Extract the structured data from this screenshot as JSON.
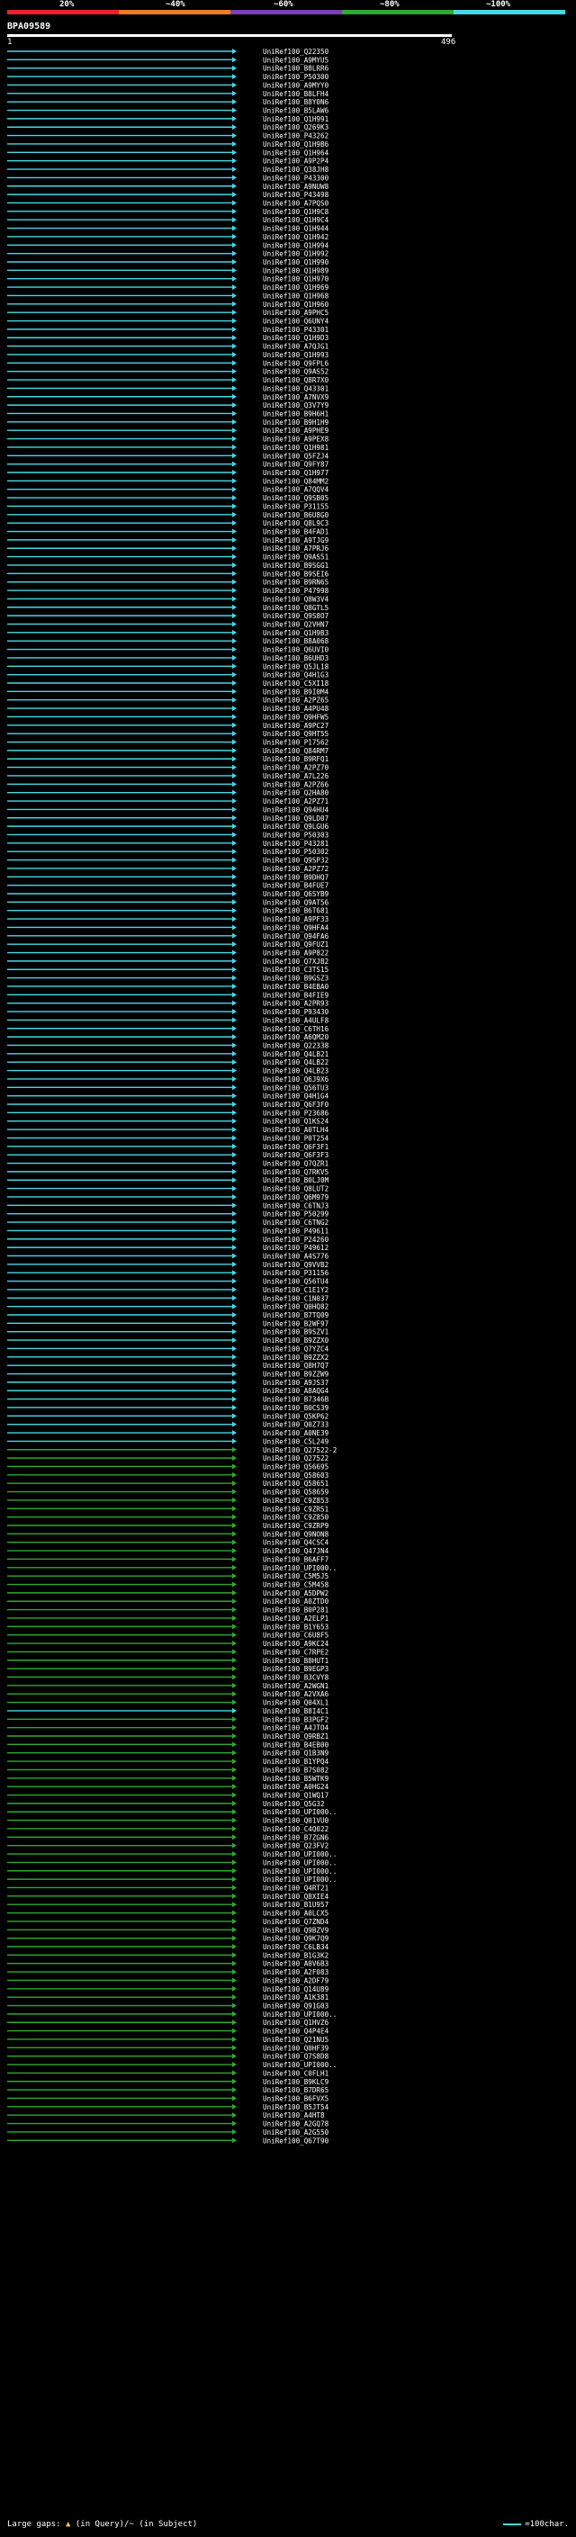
{
  "legend": {
    "labels": [
      "20%",
      "~40%",
      "~60%",
      "~80%",
      "~100%"
    ],
    "colors": [
      "#e8212b",
      "#f07c1b",
      "#7b3fb8",
      "#2eaa2e",
      "#44d9e6"
    ]
  },
  "query": {
    "id": "BPA09589",
    "start": "1",
    "end": "496"
  },
  "hits": [
    {
      "id": "UniRef100_Q22350",
      "color": "cyan"
    },
    {
      "id": "UniRef100_A9MYU5",
      "color": "cyan"
    },
    {
      "id": "UniRef100_B8LRR6",
      "color": "cyan"
    },
    {
      "id": "UniRef100_P50300",
      "color": "cyan"
    },
    {
      "id": "UniRef100_A9MYY0",
      "color": "cyan"
    },
    {
      "id": "UniRef100_B8LFH4",
      "color": "cyan"
    },
    {
      "id": "UniRef100_B8Y0N6",
      "color": "cyan"
    },
    {
      "id": "UniRef100_B5LAW6",
      "color": "cyan"
    },
    {
      "id": "UniRef100_Q1H991",
      "color": "cyan"
    },
    {
      "id": "UniRef100_Q269K3",
      "color": "cyan"
    },
    {
      "id": "UniRef100_P43262",
      "color": "cyan"
    },
    {
      "id": "UniRef100_Q1H9B6",
      "color": "cyan"
    },
    {
      "id": "UniRef100_Q1H964",
      "color": "cyan"
    },
    {
      "id": "UniRef100_A9P2P4",
      "color": "cyan"
    },
    {
      "id": "UniRef100_Q38JH8",
      "color": "cyan"
    },
    {
      "id": "UniRef100_P43300",
      "color": "cyan"
    },
    {
      "id": "UniRef100_A9NUW8",
      "color": "cyan"
    },
    {
      "id": "UniRef100_P43498",
      "color": "cyan"
    },
    {
      "id": "UniRef100_A7PQS0",
      "color": "cyan"
    },
    {
      "id": "UniRef100_Q1H9C8",
      "color": "cyan"
    },
    {
      "id": "UniRef100_Q1H9C4",
      "color": "cyan"
    },
    {
      "id": "UniRef100_Q1H944",
      "color": "cyan"
    },
    {
      "id": "UniRef100_Q1H942",
      "color": "cyan"
    },
    {
      "id": "UniRef100_Q1H994",
      "color": "cyan"
    },
    {
      "id": "UniRef100_Q1H992",
      "color": "cyan"
    },
    {
      "id": "UniRef100_Q1H990",
      "color": "cyan"
    },
    {
      "id": "UniRef100_Q1H989",
      "color": "cyan"
    },
    {
      "id": "UniRef100_Q1H970",
      "color": "cyan"
    },
    {
      "id": "UniRef100_Q1H969",
      "color": "cyan"
    },
    {
      "id": "UniRef100_Q1H968",
      "color": "cyan"
    },
    {
      "id": "UniRef100_Q1H960",
      "color": "cyan"
    },
    {
      "id": "UniRef100_A9PHC5",
      "color": "cyan"
    },
    {
      "id": "UniRef100_Q6UNY4",
      "color": "cyan"
    },
    {
      "id": "UniRef100_P43301",
      "color": "cyan"
    },
    {
      "id": "UniRef100_Q1H9D3",
      "color": "cyan"
    },
    {
      "id": "UniRef100_A7QJG1",
      "color": "cyan"
    },
    {
      "id": "UniRef100_Q1H993",
      "color": "cyan"
    },
    {
      "id": "UniRef100_Q9FPL6",
      "color": "cyan"
    },
    {
      "id": "UniRef100_Q9AS52",
      "color": "cyan"
    },
    {
      "id": "UniRef100_Q8R7X0",
      "color": "cyan"
    },
    {
      "id": "UniRef100_Q43301",
      "color": "cyan"
    },
    {
      "id": "UniRef100_A7NVX9",
      "color": "cyan"
    },
    {
      "id": "UniRef100_Q3V7Y9",
      "color": "cyan"
    },
    {
      "id": "UniRef100_B9H6H1",
      "color": "cyan"
    },
    {
      "id": "UniRef100_B9H1H9",
      "color": "cyan"
    },
    {
      "id": "UniRef100_A9PHE9",
      "color": "cyan"
    },
    {
      "id": "UniRef100_A9PEX8",
      "color": "cyan"
    },
    {
      "id": "UniRef100_Q1H981",
      "color": "cyan"
    },
    {
      "id": "UniRef100_Q5FZJ4",
      "color": "cyan"
    },
    {
      "id": "UniRef100_Q9FY87",
      "color": "cyan"
    },
    {
      "id": "UniRef100_Q1H977",
      "color": "cyan"
    },
    {
      "id": "UniRef100_Q84MM2",
      "color": "cyan"
    },
    {
      "id": "UniRef100_A7QQV4",
      "color": "cyan"
    },
    {
      "id": "UniRef100_Q9SB05",
      "color": "cyan"
    },
    {
      "id": "UniRef100_P31155",
      "color": "cyan"
    },
    {
      "id": "UniRef100_B6U8G0",
      "color": "cyan"
    },
    {
      "id": "UniRef100_Q8L9C3",
      "color": "cyan"
    },
    {
      "id": "UniRef100_B4FAD1",
      "color": "cyan"
    },
    {
      "id": "UniRef100_A9TJG9",
      "color": "cyan"
    },
    {
      "id": "UniRef100_A7PRJ6",
      "color": "cyan"
    },
    {
      "id": "UniRef100_Q9AS51",
      "color": "cyan"
    },
    {
      "id": "UniRef100_B9SGG1",
      "color": "cyan"
    },
    {
      "id": "UniRef100_B9SEI6",
      "color": "cyan"
    },
    {
      "id": "UniRef100_B9RN65",
      "color": "cyan"
    },
    {
      "id": "UniRef100_P47998",
      "color": "cyan"
    },
    {
      "id": "UniRef100_Q8W3V4",
      "color": "cyan"
    },
    {
      "id": "UniRef100_Q8GTL5",
      "color": "cyan"
    },
    {
      "id": "UniRef100_Q9S8O7",
      "color": "cyan"
    },
    {
      "id": "UniRef100_Q2VHN7",
      "color": "cyan"
    },
    {
      "id": "UniRef100_Q1H9B3",
      "color": "cyan"
    },
    {
      "id": "UniRef100_B8A068",
      "color": "cyan"
    },
    {
      "id": "UniRef100_Q6UVI0",
      "color": "cyan"
    },
    {
      "id": "UniRef100_B6UHD3",
      "color": "cyan"
    },
    {
      "id": "UniRef100_Q5JL18",
      "color": "cyan"
    },
    {
      "id": "UniRef100_Q4H1G3",
      "color": "cyan"
    },
    {
      "id": "UniRef100_C5XI18",
      "color": "cyan"
    },
    {
      "id": "UniRef100_B9I0M4",
      "color": "cyan"
    },
    {
      "id": "UniRef100_A2PZ65",
      "color": "cyan"
    },
    {
      "id": "UniRef100_A4PU48",
      "color": "cyan"
    },
    {
      "id": "UniRef100_Q9HFW5",
      "color": "cyan"
    },
    {
      "id": "UniRef100_A9PC27",
      "color": "cyan"
    },
    {
      "id": "UniRef100_Q9HT55",
      "color": "cyan"
    },
    {
      "id": "UniRef100_P17562",
      "color": "cyan"
    },
    {
      "id": "UniRef100_Q84RM7",
      "color": "cyan"
    },
    {
      "id": "UniRef100_B9RFQ1",
      "color": "cyan"
    },
    {
      "id": "UniRef100_A2PZ70",
      "color": "cyan"
    },
    {
      "id": "UniRef100_A7L226",
      "color": "cyan"
    },
    {
      "id": "UniRef100_A2PZ66",
      "color": "cyan"
    },
    {
      "id": "UniRef100_Q2HA80",
      "color": "cyan"
    },
    {
      "id": "UniRef100_A2PZ71",
      "color": "cyan"
    },
    {
      "id": "UniRef100_Q94HU4",
      "color": "cyan"
    },
    {
      "id": "UniRef100_Q9LD07",
      "color": "cyan"
    },
    {
      "id": "UniRef100_Q9LGU6",
      "color": "cyan"
    },
    {
      "id": "UniRef100_P50303",
      "color": "cyan"
    },
    {
      "id": "UniRef100_P43281",
      "color": "cyan"
    },
    {
      "id": "UniRef100_P50302",
      "color": "cyan"
    },
    {
      "id": "UniRef100_Q9SP32",
      "color": "cyan"
    },
    {
      "id": "UniRef100_A2PZ72",
      "color": "cyan"
    },
    {
      "id": "UniRef100_B9DHQ7",
      "color": "cyan"
    },
    {
      "id": "UniRef100_B4FUE7",
      "color": "cyan"
    },
    {
      "id": "UniRef100_Q6SYB9",
      "color": "cyan"
    },
    {
      "id": "UniRef100_Q9AT56",
      "color": "cyan"
    },
    {
      "id": "UniRef100_B6T681",
      "color": "cyan"
    },
    {
      "id": "UniRef100_A9PF33",
      "color": "cyan"
    },
    {
      "id": "UniRef100_Q9HFA4",
      "color": "cyan"
    },
    {
      "id": "UniRef100_Q94FA6",
      "color": "cyan"
    },
    {
      "id": "UniRef100_Q9FUZ1",
      "color": "cyan"
    },
    {
      "id": "UniRef100_A9P822",
      "color": "cyan"
    },
    {
      "id": "UniRef100_Q7XJB2",
      "color": "cyan"
    },
    {
      "id": "UniRef100_C3TS15",
      "color": "cyan"
    },
    {
      "id": "UniRef100_B9GSZ3",
      "color": "cyan"
    },
    {
      "id": "UniRef100_B4EBA0",
      "color": "cyan"
    },
    {
      "id": "UniRef100_B4FIE9",
      "color": "cyan"
    },
    {
      "id": "UniRef100_A2PR93",
      "color": "cyan"
    },
    {
      "id": "UniRef100_P93430",
      "color": "cyan"
    },
    {
      "id": "UniRef100_A4ULF8",
      "color": "cyan"
    },
    {
      "id": "UniRef100_C6TH16",
      "color": "cyan"
    },
    {
      "id": "UniRef100_A6QM20",
      "color": "cyan"
    },
    {
      "id": "UniRef100_Q22338",
      "color": "cyan"
    },
    {
      "id": "UniRef100_Q4LB21",
      "color": "cyan"
    },
    {
      "id": "UniRef100_Q4LB22",
      "color": "cyan"
    },
    {
      "id": "UniRef100_Q4LB23",
      "color": "cyan"
    },
    {
      "id": "UniRef100_Q6J9X6",
      "color": "cyan"
    },
    {
      "id": "UniRef100_Q56TU3",
      "color": "cyan"
    },
    {
      "id": "UniRef100_Q4H1G4",
      "color": "cyan"
    },
    {
      "id": "UniRef100_Q6F3F0",
      "color": "cyan"
    },
    {
      "id": "UniRef100_P23686",
      "color": "cyan"
    },
    {
      "id": "UniRef100_Q1KS24",
      "color": "cyan"
    },
    {
      "id": "UniRef100_A0TLH4",
      "color": "cyan"
    },
    {
      "id": "UniRef100_P0T254",
      "color": "cyan"
    },
    {
      "id": "UniRef100_Q6F3F1",
      "color": "cyan"
    },
    {
      "id": "UniRef100_Q6F3F3",
      "color": "cyan"
    },
    {
      "id": "UniRef100_Q7QZR1",
      "color": "cyan"
    },
    {
      "id": "UniRef100_Q7RKV5",
      "color": "cyan"
    },
    {
      "id": "UniRef100_B0LJ0M",
      "color": "cyan"
    },
    {
      "id": "UniRef100_Q8LUT2",
      "color": "cyan"
    },
    {
      "id": "UniRef100_Q6M979",
      "color": "cyan"
    },
    {
      "id": "UniRef100_C6TNJ3",
      "color": "cyan"
    },
    {
      "id": "UniRef100_P50299",
      "color": "cyan"
    },
    {
      "id": "UniRef100_C6TNG2",
      "color": "cyan"
    },
    {
      "id": "UniRef100_P49611",
      "color": "cyan"
    },
    {
      "id": "UniRef100_P24260",
      "color": "cyan"
    },
    {
      "id": "UniRef100_P49612",
      "color": "cyan"
    },
    {
      "id": "UniRef100_A4S776",
      "color": "cyan"
    },
    {
      "id": "UniRef100_Q9VVB2",
      "color": "cyan"
    },
    {
      "id": "UniRef100_P31156",
      "color": "cyan"
    },
    {
      "id": "UniRef100_Q56TU4",
      "color": "cyan"
    },
    {
      "id": "UniRef100_C1E1Y2",
      "color": "cyan"
    },
    {
      "id": "UniRef100_C1N037",
      "color": "cyan"
    },
    {
      "id": "UniRef100_Q0HQ82",
      "color": "cyan"
    },
    {
      "id": "UniRef100_B7TQ09",
      "color": "cyan"
    },
    {
      "id": "UniRef100_B2WF97",
      "color": "cyan"
    },
    {
      "id": "UniRef100_B9SZV1",
      "color": "cyan"
    },
    {
      "id": "UniRef100_B9ZZX0",
      "color": "cyan"
    },
    {
      "id": "UniRef100_Q7YZC4",
      "color": "cyan"
    },
    {
      "id": "UniRef100_B9ZZX2",
      "color": "cyan"
    },
    {
      "id": "UniRef100_Q8H7Q7",
      "color": "cyan"
    },
    {
      "id": "UniRef100_B9ZZW9",
      "color": "cyan"
    },
    {
      "id": "UniRef100_A9JS37",
      "color": "cyan"
    },
    {
      "id": "UniRef100_A8AQG4",
      "color": "cyan"
    },
    {
      "id": "UniRef100_B7346B",
      "color": "cyan"
    },
    {
      "id": "UniRef100_B0CS39",
      "color": "cyan"
    },
    {
      "id": "UniRef100_Q5KP62",
      "color": "cyan"
    },
    {
      "id": "UniRef100_Q0Z733",
      "color": "cyan"
    },
    {
      "id": "UniRef100_A0NE39",
      "color": "cyan"
    },
    {
      "id": "UniRef100_C5L249",
      "color": "cyan"
    },
    {
      "id": "UniRef100_Q27522-2",
      "color": "green"
    },
    {
      "id": "UniRef100_Q27522",
      "color": "green"
    },
    {
      "id": "UniRef100_Q56695",
      "color": "green"
    },
    {
      "id": "UniRef100_Q58603",
      "color": "green"
    },
    {
      "id": "UniRef100_Q58651",
      "color": "green"
    },
    {
      "id": "UniRef100_Q58659",
      "color": "green"
    },
    {
      "id": "UniRef100_C9Z853",
      "color": "green"
    },
    {
      "id": "UniRef100_C9ZRS1",
      "color": "green"
    },
    {
      "id": "UniRef100_C9Z850",
      "color": "green"
    },
    {
      "id": "UniRef100_C9ZRP9",
      "color": "green"
    },
    {
      "id": "UniRef100_Q9NON8",
      "color": "green"
    },
    {
      "id": "UniRef100_Q4CSC4",
      "color": "green"
    },
    {
      "id": "UniRef100_Q47JN4",
      "color": "green"
    },
    {
      "id": "UniRef100_B6AFF7",
      "color": "green"
    },
    {
      "id": "UniRef100_UPI000..",
      "color": "green"
    },
    {
      "id": "UniRef100_C5M5J5",
      "color": "green"
    },
    {
      "id": "UniRef100_C5M458",
      "color": "green"
    },
    {
      "id": "UniRef100_A5DPW2",
      "color": "green"
    },
    {
      "id": "UniRef100_A0ZTD0",
      "color": "green"
    },
    {
      "id": "UniRef100_B0P281",
      "color": "green"
    },
    {
      "id": "UniRef100_A2ELP1",
      "color": "green"
    },
    {
      "id": "UniRef100_B1Y653",
      "color": "green"
    },
    {
      "id": "UniRef100_C6U8F5",
      "color": "green"
    },
    {
      "id": "UniRef100_A9KC24",
      "color": "green"
    },
    {
      "id": "UniRef100_C7RPE2",
      "color": "green"
    },
    {
      "id": "UniRef100_B8HUT1",
      "color": "green"
    },
    {
      "id": "UniRef100_B9EGP3",
      "color": "green"
    },
    {
      "id": "UniRef100_B3CVY8",
      "color": "green"
    },
    {
      "id": "UniRef100_A2WGN1",
      "color": "green"
    },
    {
      "id": "UniRef100_A2VXA6",
      "color": "green"
    },
    {
      "id": "UniRef100_Q04XL1",
      "color": "green"
    },
    {
      "id": "UniRef100_B8I4C1",
      "color": "cyan"
    },
    {
      "id": "UniRef100_B3PGF2",
      "color": "green"
    },
    {
      "id": "UniRef100_A4JTO4",
      "color": "green"
    },
    {
      "id": "UniRef100_Q9RBZ1",
      "color": "green"
    },
    {
      "id": "UniRef100_B4EB00",
      "color": "green"
    },
    {
      "id": "UniRef100_Q1B3N9",
      "color": "green"
    },
    {
      "id": "UniRef100_B1YPQ4",
      "color": "green"
    },
    {
      "id": "UniRef100_B7S082",
      "color": "green"
    },
    {
      "id": "UniRef100_B5WTK9",
      "color": "green"
    },
    {
      "id": "UniRef100_A0HG24",
      "color": "green"
    },
    {
      "id": "UniRef100_Q1WQ17",
      "color": "green"
    },
    {
      "id": "UniRef100_Q5G32",
      "color": "green"
    },
    {
      "id": "UniRef100_UPI000..",
      "color": "green"
    },
    {
      "id": "UniRef100_Q01VU0",
      "color": "green"
    },
    {
      "id": "UniRef100_C4Q022",
      "color": "green"
    },
    {
      "id": "UniRef100_B7ZGN6",
      "color": "green"
    },
    {
      "id": "UniRef100_Q23FV2",
      "color": "green"
    },
    {
      "id": "UniRef100_UPI000..",
      "color": "green"
    },
    {
      "id": "UniRef100_UPI000..",
      "color": "green"
    },
    {
      "id": "UniRef100_UPI000..",
      "color": "green"
    },
    {
      "id": "UniRef100_UPI000..",
      "color": "green"
    },
    {
      "id": "UniRef100_Q4RT21",
      "color": "green"
    },
    {
      "id": "UniRef100_Q8XIE4",
      "color": "green"
    },
    {
      "id": "UniRef100_B1U957",
      "color": "green"
    },
    {
      "id": "UniRef100_A0LCX5",
      "color": "green"
    },
    {
      "id": "UniRef100_Q7ZND4",
      "color": "green"
    },
    {
      "id": "UniRef100_Q9BZV9",
      "color": "green"
    },
    {
      "id": "UniRef100_Q9K7Q9",
      "color": "green"
    },
    {
      "id": "UniRef100_C6LB34",
      "color": "green"
    },
    {
      "id": "UniRef100_B1G3K2",
      "color": "green"
    },
    {
      "id": "UniRef100_A0V6B3",
      "color": "green"
    },
    {
      "id": "UniRef100_A2F083",
      "color": "green"
    },
    {
      "id": "UniRef100_A2DF79",
      "color": "green"
    },
    {
      "id": "UniRef100_Q14U89",
      "color": "green"
    },
    {
      "id": "UniRef100_A1K381",
      "color": "green"
    },
    {
      "id": "UniRef100_Q91G03",
      "color": "green"
    },
    {
      "id": "UniRef100_UPI000..",
      "color": "green"
    },
    {
      "id": "UniRef100_Q1HVZ6",
      "color": "green"
    },
    {
      "id": "UniRef100_Q4P4E4",
      "color": "green"
    },
    {
      "id": "UniRef100_Q21NU5",
      "color": "green"
    },
    {
      "id": "UniRef100_Q0HF39",
      "color": "green"
    },
    {
      "id": "UniRef100_Q7S8D8",
      "color": "green"
    },
    {
      "id": "UniRef100_UPI000..",
      "color": "green"
    },
    {
      "id": "UniRef100_C0FLH1",
      "color": "green"
    },
    {
      "id": "UniRef100_B9KLC9",
      "color": "green"
    },
    {
      "id": "UniRef100_B7DR65",
      "color": "green"
    },
    {
      "id": "UniRef100_B6FVX5",
      "color": "green"
    },
    {
      "id": "UniRef100_B5JT54",
      "color": "green"
    },
    {
      "id": "UniRef100_A4HT8",
      "color": "green"
    },
    {
      "id": "UniRef100_A2GQ78",
      "color": "green"
    },
    {
      "id": "UniRef100_A2G550",
      "color": "green"
    },
    {
      "id": "UniRef100_Q67T90",
      "color": "green"
    }
  ],
  "footer": {
    "gaps_label": "Large gaps:",
    "gaps_legend": "(in Query)/~ (in Subject)",
    "scale_label": "=100char."
  },
  "colors": {
    "cyan": "#44d9e6",
    "green": "#2eaa2e",
    "background": "#000000",
    "text": "#ffffff"
  }
}
